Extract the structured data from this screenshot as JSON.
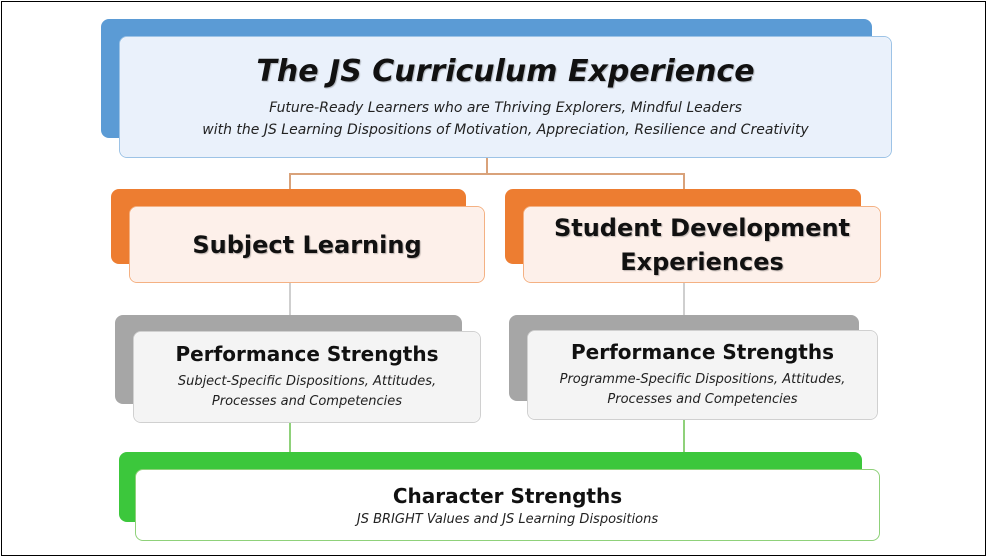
{
  "top": {
    "title": "The JS Curriculum Experience",
    "line1": "Future-Ready Learners who are Thriving Explorers, Mindful Leaders",
    "line2": "with the JS Learning Dispositions of Motivation, Appreciation, Resilience and Creativity"
  },
  "left_branch": {
    "title": "Subject Learning",
    "perf_title": "Performance Strengths",
    "perf_line1": "Subject-Specific Dispositions, Attitudes,",
    "perf_line2": "Processes and Competencies"
  },
  "right_branch": {
    "title_line1": "Student Development",
    "title_line2": "Experiences",
    "perf_title": "Performance Strengths",
    "perf_line1": "Programme-Specific Dispositions, Attitudes,",
    "perf_line2": "Processes and Competencies"
  },
  "bottom": {
    "title": "Character Strengths",
    "subtitle": "JS BRIGHT Values and JS Learning Dispositions"
  },
  "colors": {
    "blue": "#5b9bd5",
    "blue_fill": "#eaf1fb",
    "orange": "#ed7d31",
    "orange_fill": "#fdf0ea",
    "grey": "#a6a6a6",
    "grey_fill": "#f2f2f2",
    "green": "#3cc73c",
    "connector": "#d9a27a"
  }
}
